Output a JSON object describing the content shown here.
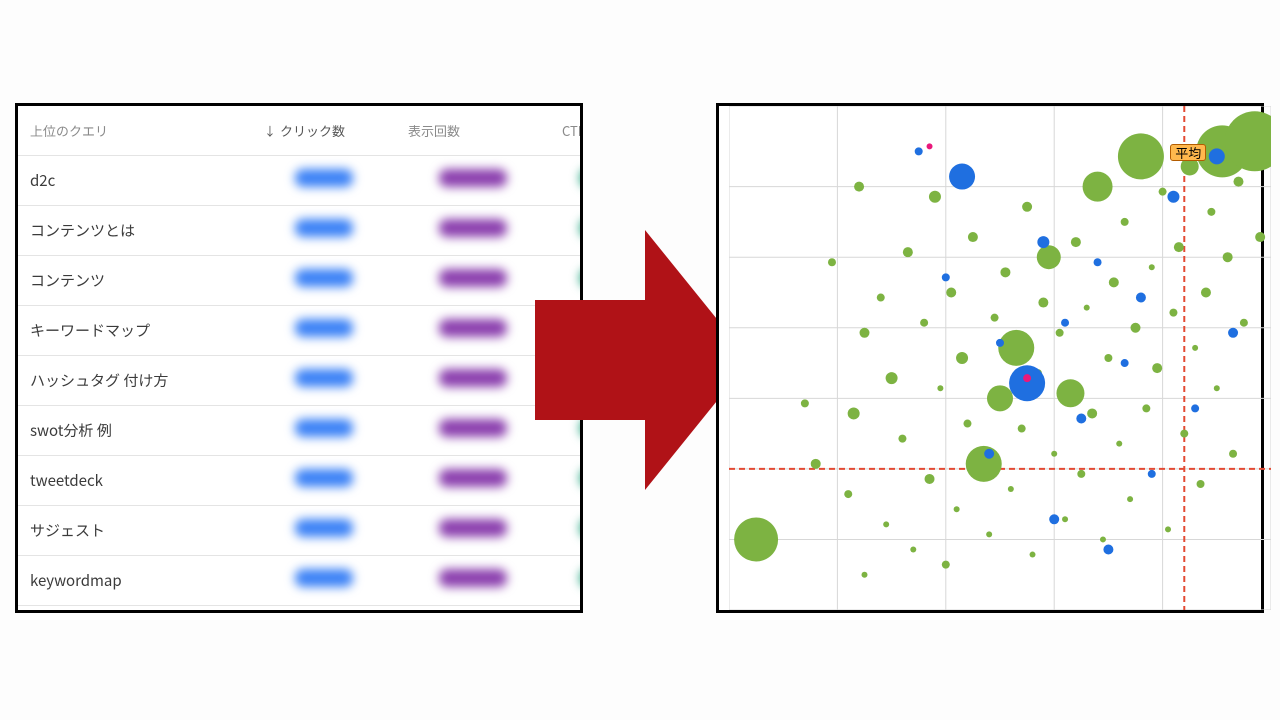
{
  "table": {
    "headers": {
      "query": "上位のクエリ",
      "clicks": "クリック数",
      "impressions": "表示回数",
      "ctr": "CTR"
    },
    "sort_indicator": "↓",
    "rows": [
      {
        "query": "d2c"
      },
      {
        "query": "コンテンツとは"
      },
      {
        "query": "コンテンツ"
      },
      {
        "query": "キーワードマップ"
      },
      {
        "query": "ハッシュタグ 付け方"
      },
      {
        "query": "swot分析 例"
      },
      {
        "query": "tweetdeck"
      },
      {
        "query": "サジェスト"
      },
      {
        "query": "keywordmap"
      }
    ]
  },
  "chart": {
    "avg_label": "平均"
  },
  "chart_data": {
    "type": "scatter",
    "title": "",
    "xlabel": "",
    "ylabel": "",
    "xlim": [
      0,
      100
    ],
    "ylim": [
      0,
      100
    ],
    "avg_x": 84,
    "avg_y": 28,
    "grid_x": [
      0,
      20,
      40,
      60,
      80,
      100
    ],
    "grid_y": [
      0,
      14,
      28,
      42,
      56,
      70,
      84,
      100
    ],
    "series": [
      {
        "name": "green",
        "color": "#7db342",
        "points": [
          {
            "x": 5,
            "y": 14,
            "r": 22
          },
          {
            "x": 14,
            "y": 41,
            "r": 4
          },
          {
            "x": 16,
            "y": 29,
            "r": 5
          },
          {
            "x": 19,
            "y": 69,
            "r": 4
          },
          {
            "x": 22,
            "y": 23,
            "r": 4
          },
          {
            "x": 23,
            "y": 39,
            "r": 6
          },
          {
            "x": 25,
            "y": 7,
            "r": 3
          },
          {
            "x": 25,
            "y": 55,
            "r": 5
          },
          {
            "x": 28,
            "y": 62,
            "r": 4
          },
          {
            "x": 29,
            "y": 17,
            "r": 3
          },
          {
            "x": 30,
            "y": 46,
            "r": 6
          },
          {
            "x": 32,
            "y": 34,
            "r": 4
          },
          {
            "x": 33,
            "y": 71,
            "r": 5
          },
          {
            "x": 34,
            "y": 12,
            "r": 3
          },
          {
            "x": 36,
            "y": 57,
            "r": 4
          },
          {
            "x": 37,
            "y": 26,
            "r": 5
          },
          {
            "x": 38,
            "y": 82,
            "r": 6
          },
          {
            "x": 39,
            "y": 44,
            "r": 3
          },
          {
            "x": 40,
            "y": 9,
            "r": 4
          },
          {
            "x": 41,
            "y": 63,
            "r": 5
          },
          {
            "x": 42,
            "y": 20,
            "r": 3
          },
          {
            "x": 43,
            "y": 50,
            "r": 6
          },
          {
            "x": 44,
            "y": 37,
            "r": 4
          },
          {
            "x": 45,
            "y": 74,
            "r": 5
          },
          {
            "x": 47,
            "y": 29,
            "r": 18
          },
          {
            "x": 48,
            "y": 15,
            "r": 3
          },
          {
            "x": 49,
            "y": 58,
            "r": 4
          },
          {
            "x": 50,
            "y": 42,
            "r": 13
          },
          {
            "x": 51,
            "y": 67,
            "r": 5
          },
          {
            "x": 52,
            "y": 24,
            "r": 3
          },
          {
            "x": 53,
            "y": 52,
            "r": 18
          },
          {
            "x": 54,
            "y": 36,
            "r": 4
          },
          {
            "x": 55,
            "y": 80,
            "r": 5
          },
          {
            "x": 56,
            "y": 11,
            "r": 3
          },
          {
            "x": 57,
            "y": 47,
            "r": 4
          },
          {
            "x": 58,
            "y": 61,
            "r": 5
          },
          {
            "x": 59,
            "y": 70,
            "r": 12
          },
          {
            "x": 60,
            "y": 31,
            "r": 3
          },
          {
            "x": 61,
            "y": 55,
            "r": 4
          },
          {
            "x": 62,
            "y": 18,
            "r": 3
          },
          {
            "x": 63,
            "y": 43,
            "r": 14
          },
          {
            "x": 64,
            "y": 73,
            "r": 5
          },
          {
            "x": 65,
            "y": 27,
            "r": 4
          },
          {
            "x": 66,
            "y": 60,
            "r": 3
          },
          {
            "x": 67,
            "y": 39,
            "r": 5
          },
          {
            "x": 68,
            "y": 84,
            "r": 15
          },
          {
            "x": 69,
            "y": 14,
            "r": 3
          },
          {
            "x": 70,
            "y": 50,
            "r": 4
          },
          {
            "x": 71,
            "y": 65,
            "r": 5
          },
          {
            "x": 72,
            "y": 33,
            "r": 3
          },
          {
            "x": 73,
            "y": 77,
            "r": 4
          },
          {
            "x": 74,
            "y": 22,
            "r": 3
          },
          {
            "x": 75,
            "y": 56,
            "r": 5
          },
          {
            "x": 76,
            "y": 90,
            "r": 23
          },
          {
            "x": 77,
            "y": 40,
            "r": 4
          },
          {
            "x": 78,
            "y": 68,
            "r": 3
          },
          {
            "x": 79,
            "y": 48,
            "r": 5
          },
          {
            "x": 80,
            "y": 83,
            "r": 4
          },
          {
            "x": 81,
            "y": 16,
            "r": 3
          },
          {
            "x": 82,
            "y": 59,
            "r": 4
          },
          {
            "x": 83,
            "y": 72,
            "r": 5
          },
          {
            "x": 84,
            "y": 35,
            "r": 4
          },
          {
            "x": 85,
            "y": 88,
            "r": 9
          },
          {
            "x": 86,
            "y": 52,
            "r": 3
          },
          {
            "x": 87,
            "y": 25,
            "r": 4
          },
          {
            "x": 88,
            "y": 63,
            "r": 5
          },
          {
            "x": 89,
            "y": 79,
            "r": 4
          },
          {
            "x": 90,
            "y": 44,
            "r": 3
          },
          {
            "x": 91,
            "y": 91,
            "r": 26
          },
          {
            "x": 92,
            "y": 70,
            "r": 5
          },
          {
            "x": 93,
            "y": 31,
            "r": 4
          },
          {
            "x": 94,
            "y": 85,
            "r": 5
          },
          {
            "x": 95,
            "y": 57,
            "r": 4
          },
          {
            "x": 97,
            "y": 93,
            "r": 30
          },
          {
            "x": 98,
            "y": 74,
            "r": 5
          },
          {
            "x": 24,
            "y": 84,
            "r": 5
          }
        ]
      },
      {
        "name": "blue",
        "color": "#1f6fe0",
        "points": [
          {
            "x": 35,
            "y": 91,
            "r": 4
          },
          {
            "x": 40,
            "y": 66,
            "r": 4
          },
          {
            "x": 43,
            "y": 86,
            "r": 13
          },
          {
            "x": 48,
            "y": 31,
            "r": 5
          },
          {
            "x": 50,
            "y": 53,
            "r": 4
          },
          {
            "x": 55,
            "y": 45,
            "r": 18
          },
          {
            "x": 58,
            "y": 73,
            "r": 6
          },
          {
            "x": 60,
            "y": 18,
            "r": 5
          },
          {
            "x": 62,
            "y": 57,
            "r": 4
          },
          {
            "x": 65,
            "y": 38,
            "r": 5
          },
          {
            "x": 68,
            "y": 69,
            "r": 4
          },
          {
            "x": 70,
            "y": 12,
            "r": 5
          },
          {
            "x": 73,
            "y": 49,
            "r": 4
          },
          {
            "x": 76,
            "y": 62,
            "r": 5
          },
          {
            "x": 78,
            "y": 27,
            "r": 4
          },
          {
            "x": 82,
            "y": 82,
            "r": 6
          },
          {
            "x": 86,
            "y": 40,
            "r": 4
          },
          {
            "x": 90,
            "y": 90,
            "r": 8
          },
          {
            "x": 93,
            "y": 55,
            "r": 5
          }
        ]
      },
      {
        "name": "pink",
        "color": "#e9187b",
        "points": [
          {
            "x": 37,
            "y": 92,
            "r": 3
          },
          {
            "x": 55,
            "y": 46,
            "r": 4
          }
        ]
      }
    ]
  }
}
